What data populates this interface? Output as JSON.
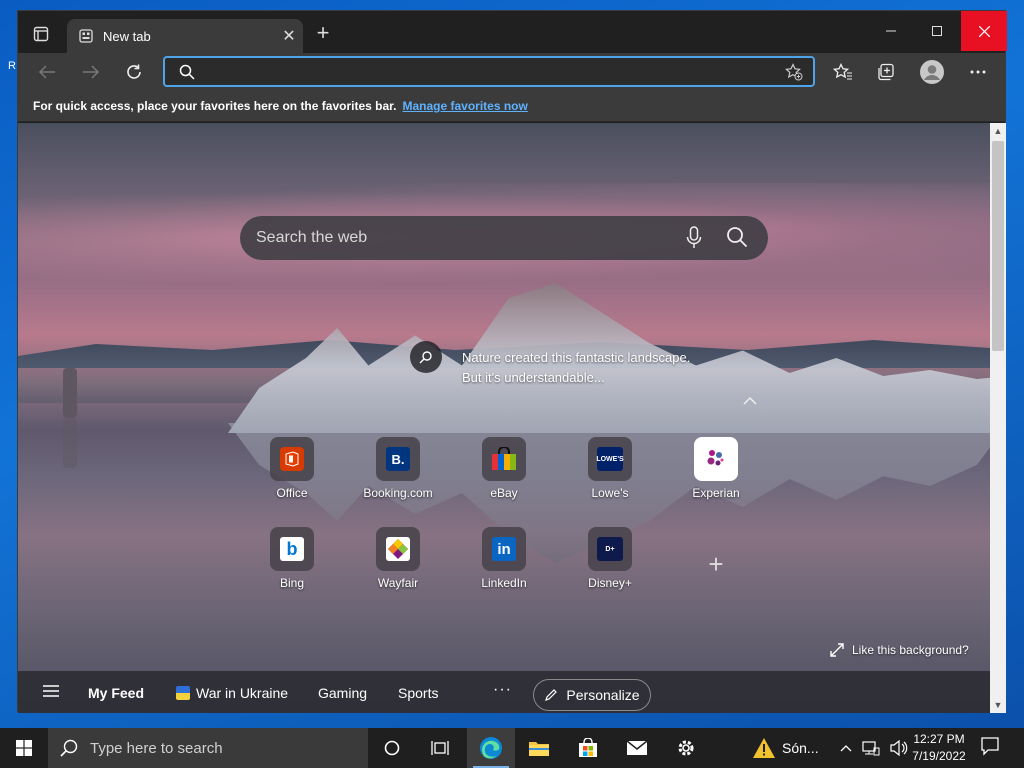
{
  "desktop": {
    "edge_fragment": "R"
  },
  "browser": {
    "tab_title": "New tab",
    "address_value": "",
    "address_placeholder": "",
    "favorites_bar": {
      "text": "For quick access, place your favorites here on the favorites bar.",
      "link": "Manage favorites now"
    }
  },
  "newtab": {
    "search_placeholder": "Search the web",
    "caption_line1": "Nature created this fantastic landscape.",
    "caption_line2": "But it's understandable...",
    "tiles": [
      {
        "label": "Office"
      },
      {
        "label": "Booking.com"
      },
      {
        "label": "eBay"
      },
      {
        "label": "Lowe's"
      },
      {
        "label": "Experian"
      },
      {
        "label": "Bing"
      },
      {
        "label": "Wayfair"
      },
      {
        "label": "LinkedIn"
      },
      {
        "label": "Disney+"
      }
    ],
    "like_background": "Like this background?",
    "feed": {
      "my_feed": "My Feed",
      "war_in_ukraine": "War in Ukraine",
      "gaming": "Gaming",
      "sports": "Sports",
      "more": "···",
      "personalize": "Personalize"
    }
  },
  "taskbar": {
    "search_placeholder": "Type here to search",
    "weather_text": "Són...",
    "time": "12:27 PM",
    "date": "7/19/2022"
  },
  "colors": {
    "accent": "#4fa3e8",
    "close_red": "#e81123",
    "link": "#5fb2ff",
    "taskbar": "#1f1f1f"
  }
}
